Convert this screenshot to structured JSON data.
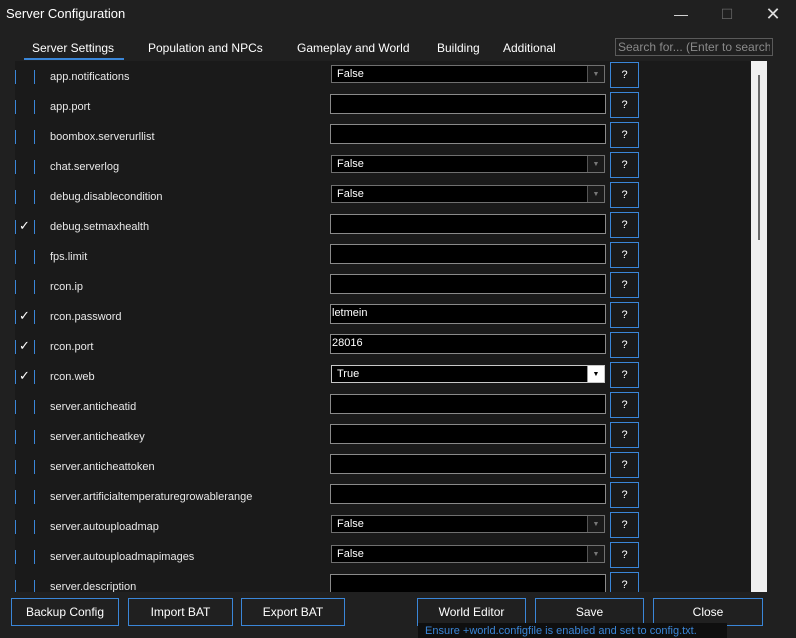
{
  "window": {
    "title": "Server Configuration",
    "minimize_glyph": "—",
    "maximize_glyph": "☐",
    "close_glyph": "✕"
  },
  "tabs": [
    {
      "label": "Server Settings",
      "active": true
    },
    {
      "label": "Population and NPCs",
      "active": false
    },
    {
      "label": "Gameplay and World",
      "active": false
    },
    {
      "label": "Building",
      "active": false
    },
    {
      "label": "Additional",
      "active": false
    }
  ],
  "search": {
    "placeholder": "Search for... (Enter to search)",
    "value": ""
  },
  "settings": [
    {
      "key": "app.notifications",
      "checked": false,
      "type": "select",
      "value": "False",
      "enabled": false
    },
    {
      "key": "app.port",
      "checked": false,
      "type": "text",
      "value": ""
    },
    {
      "key": "boombox.serverurllist",
      "checked": false,
      "type": "text",
      "value": ""
    },
    {
      "key": "chat.serverlog",
      "checked": false,
      "type": "select",
      "value": "False",
      "enabled": false
    },
    {
      "key": "debug.disablecondition",
      "checked": false,
      "type": "select",
      "value": "False",
      "enabled": false
    },
    {
      "key": "debug.setmaxhealth",
      "checked": true,
      "type": "text",
      "value": ""
    },
    {
      "key": "fps.limit",
      "checked": false,
      "type": "text",
      "value": ""
    },
    {
      "key": "rcon.ip",
      "checked": false,
      "type": "text",
      "value": ""
    },
    {
      "key": "rcon.password",
      "checked": true,
      "type": "text",
      "value": "letmein"
    },
    {
      "key": "rcon.port",
      "checked": true,
      "type": "text",
      "value": "28016"
    },
    {
      "key": "rcon.web",
      "checked": true,
      "type": "select",
      "value": "True",
      "enabled": true
    },
    {
      "key": "server.anticheatid",
      "checked": false,
      "type": "text",
      "value": ""
    },
    {
      "key": "server.anticheatkey",
      "checked": false,
      "type": "text",
      "value": ""
    },
    {
      "key": "server.anticheattoken",
      "checked": false,
      "type": "text",
      "value": ""
    },
    {
      "key": "server.artificialtemperaturegrowablerange",
      "checked": false,
      "type": "text",
      "value": ""
    },
    {
      "key": "server.autouploadmap",
      "checked": false,
      "type": "select",
      "value": "False",
      "enabled": false
    },
    {
      "key": "server.autouploadmapimages",
      "checked": false,
      "type": "select",
      "value": "False",
      "enabled": false
    },
    {
      "key": "server.description",
      "checked": false,
      "type": "text",
      "value": ""
    }
  ],
  "help_label": "?",
  "check_glyph": "✓",
  "dropdown_glyph": "▼",
  "buttons": {
    "backup": "Backup Config",
    "import": "Import BAT",
    "export": "Export BAT",
    "world_editor": "World Editor",
    "save": "Save",
    "close": "Close"
  },
  "status": "Ensure +world.configfile is enabled and set to config.txt.",
  "colors": {
    "accent": "#3a86d8",
    "background": "#202020",
    "panel": "#1a1a1a"
  }
}
